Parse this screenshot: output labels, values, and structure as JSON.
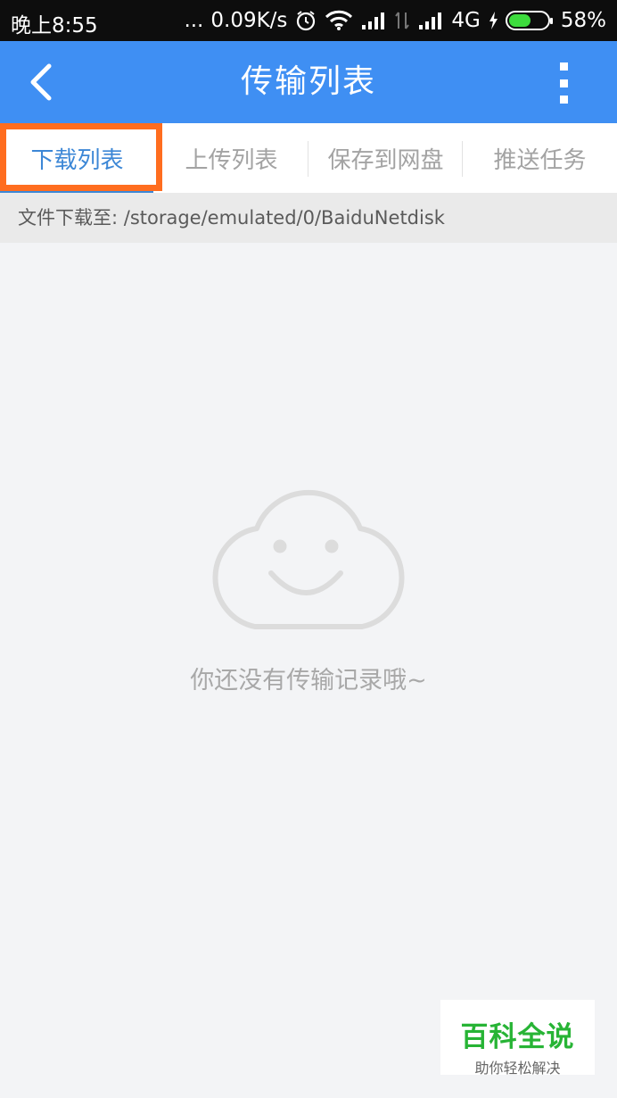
{
  "status_bar": {
    "time": "晚上8:55",
    "dots": "...",
    "speed": "0.09K/s",
    "network": "4G",
    "battery_text": "58%",
    "battery_level": 0.58,
    "icons": [
      "alarm-icon",
      "wifi-icon",
      "signal-icon",
      "data-transfer-icon",
      "signal-icon",
      "charging-icon",
      "battery-icon"
    ]
  },
  "app_bar": {
    "title": "传输列表",
    "back_icon": "chevron-left-icon",
    "menu_icon": "more-vertical-icon",
    "color": "#3f8ff3"
  },
  "tabs": [
    {
      "label": "下载列表",
      "active": true
    },
    {
      "label": "上传列表",
      "active": false
    },
    {
      "label": "保存到网盘",
      "active": false
    },
    {
      "label": "推送任务",
      "active": false
    }
  ],
  "path_bar": {
    "text": "文件下载至: /storage/emulated/0/BaiduNetdisk"
  },
  "empty_state": {
    "icon": "smiling-cloud-icon",
    "text": "你还没有传输记录哦~"
  },
  "watermark": {
    "title": "百科全说",
    "subtitle": "助你轻松解决"
  },
  "colors": {
    "accent": "#3f8ff3",
    "tab_active": "#3c87d6",
    "highlight": "#ff6d1f",
    "watermark_green": "#27b435"
  }
}
